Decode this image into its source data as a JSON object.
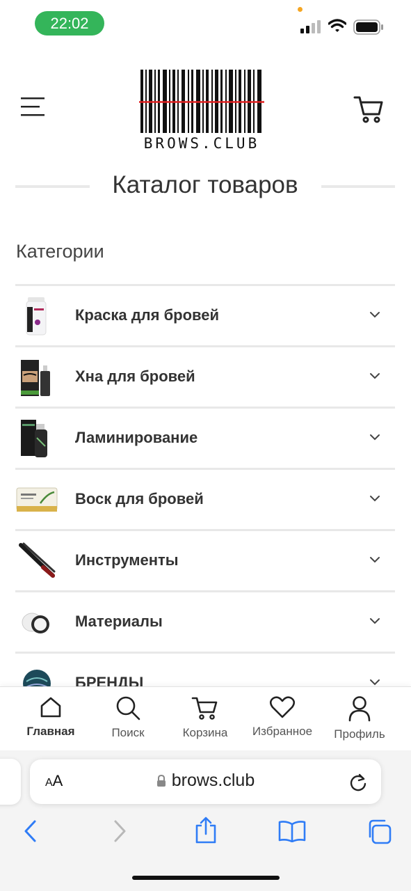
{
  "status_bar": {
    "time": "22:02",
    "time_pill_color": "#34b55a"
  },
  "header": {
    "logo_text": "BROWS.CLUB"
  },
  "catalog": {
    "title": "Каталог товаров",
    "categories_heading": "Категории"
  },
  "categories": [
    {
      "label": "Краска для бровей",
      "thumb": "tint-bottle"
    },
    {
      "label": "Хна для бровей",
      "thumb": "henna-box"
    },
    {
      "label": "Ламинирование",
      "thumb": "lamination-kit"
    },
    {
      "label": "Воск для бровей",
      "thumb": "wax-tin"
    },
    {
      "label": "Инструменты",
      "thumb": "tweezers"
    },
    {
      "label": "Материалы",
      "thumb": "materials-jar"
    },
    {
      "label": "БРЕНДЫ",
      "thumb": "brand-jar"
    }
  ],
  "tabbar": {
    "home": "Главная",
    "search": "Поиск",
    "cart": "Корзина",
    "favorites": "Избранное",
    "profile": "Профиль"
  },
  "safari": {
    "text_size_label": "AA",
    "url": "brows.club",
    "accent_color": "#2f7cf6"
  }
}
